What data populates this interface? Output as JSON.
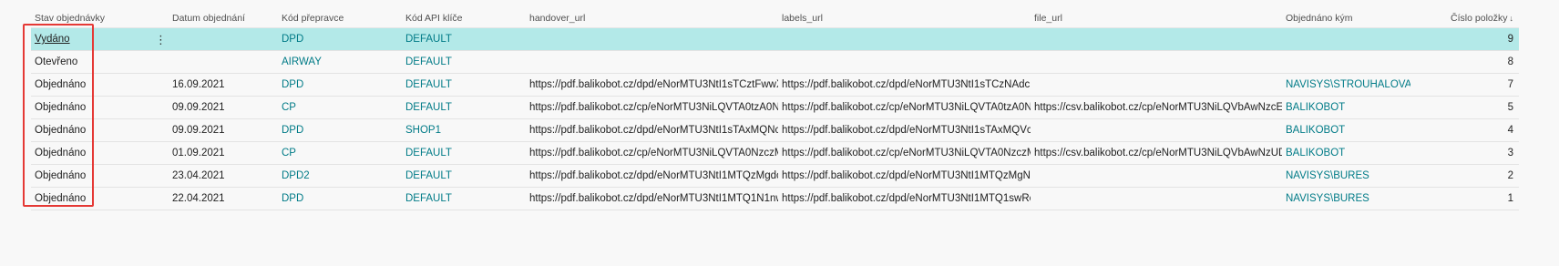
{
  "columns": {
    "status": "Stav objednávky",
    "date": "Datum objednání",
    "carrier": "Kód přepravce",
    "api_key": "Kód API klíče",
    "handover_url": "handover_url",
    "labels_url": "labels_url",
    "file_url": "file_url",
    "ordered_by": "Objednáno kým",
    "item_number": "Číslo položky",
    "sort_indicator": "↓"
  },
  "row_menu_glyph": "⋮",
  "rows": [
    {
      "status": "Vydáno",
      "date": "",
      "carrier": "DPD",
      "api_key": "DEFAULT",
      "handover_url": "",
      "labels_url": "",
      "file_url": "",
      "ordered_by": "",
      "item_number": "9"
    },
    {
      "status": "Otevřeno",
      "date": "",
      "carrier": "AIRWAY",
      "api_key": "DEFAULT",
      "handover_url": "",
      "labels_url": "",
      "file_url": "",
      "ordered_by": "",
      "item_number": "8"
    },
    {
      "status": "Objednáno",
      "date": "16.09.2021",
      "carrier": "DPD",
      "api_key": "DEFAULT",
      "handover_url": "https://pdf.balikobot.cz/dpd/eNorMTU3NtI1sTCztFwwXD...",
      "labels_url": "https://pdf.balikobot.cz/dpd/eNorMTU3NtI1sTCzNAdcM...",
      "file_url": "",
      "ordered_by": "NAVISYS\\STROUHALOVA",
      "item_number": "7"
    },
    {
      "status": "Objednáno",
      "date": "09.09.2021",
      "carrier": "CP",
      "api_key": "DEFAULT",
      "handover_url": "https://pdf.balikobot.cz/cp/eNorMTU3NiLQVTA0tzA0Nw...",
      "labels_url": "https://pdf.balikobot.cz/cp/eNorMTU3NiLQVTA0tzA0Nw...",
      "file_url": "https://csv.balikobot.cz/cp/eNorMTU3NiLQVbAwNzcEXD...",
      "ordered_by": "BALIKOBOT",
      "item_number": "5"
    },
    {
      "status": "Objednáno",
      "date": "09.09.2021",
      "carrier": "DPD",
      "api_key": "SHOP1",
      "handover_url": "https://pdf.balikobot.cz/dpd/eNorMTU3NtI1sTAxMQNc...",
      "labels_url": "https://pdf.balikobot.cz/dpd/eNorMTU3NtI1sTAxMQVcM...",
      "file_url": "",
      "ordered_by": "BALIKOBOT",
      "item_number": "4"
    },
    {
      "status": "Objednáno",
      "date": "01.09.2021",
      "carrier": "CP",
      "api_key": "DEFAULT",
      "handover_url": "https://pdf.balikobot.cz/cp/eNorMTU3NiLQVTA0NzczMA...",
      "labels_url": "https://pdf.balikobot.cz/cp/eNorMTU3NiLQVTA0NzczMA...",
      "file_url": "https://csv.balikobot.cz/cp/eNorMTU3NiLQVbAwNzUDX...",
      "ordered_by": "BALIKOBOT",
      "item_number": "3"
    },
    {
      "status": "Objednáno",
      "date": "23.04.2021",
      "carrier": "DPD2",
      "api_key": "DEFAULT",
      "handover_url": "https://pdf.balikobot.cz/dpd/eNorMTU3NtI1MTQzMgdc...",
      "labels_url": "https://pdf.balikobot.cz/dpd/eNorMTU3NtI1MTQzMgNc...",
      "file_url": "",
      "ordered_by": "NAVISYS\\BURES",
      "item_number": "2"
    },
    {
      "status": "Objednáno",
      "date": "22.04.2021",
      "carrier": "DPD",
      "api_key": "DEFAULT",
      "handover_url": "https://pdf.balikobot.cz/dpd/eNorMTU3NtI1MTQ1N1nw...",
      "labels_url": "https://pdf.balikobot.cz/dpd/eNorMTU3NtI1MTQ1swRc...",
      "file_url": "",
      "ordered_by": "NAVISYS\\BURES",
      "item_number": "1"
    }
  ],
  "colors": {
    "selected_row": "#b3e9e8",
    "link": "#007b87",
    "highlight_box": "#e53935"
  }
}
